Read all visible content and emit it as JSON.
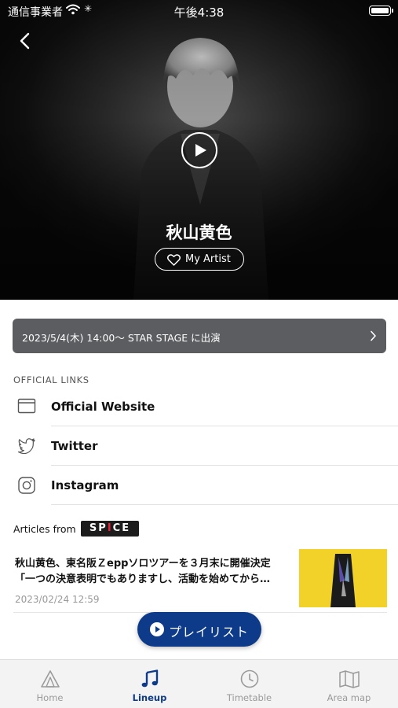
{
  "status_bar": {
    "carrier": "通信事業者",
    "time": "午後4:38"
  },
  "artist": {
    "name": "秋山黄色",
    "my_artist_label": "My Artist"
  },
  "performance": {
    "text": "2023/5/4(木) 14:00～ STAR STAGE に出演"
  },
  "official_links": {
    "heading": "OFFICIAL LINKS",
    "items": [
      {
        "label": "Official Website",
        "icon": "browser-icon"
      },
      {
        "label": "Twitter",
        "icon": "twitter-icon"
      },
      {
        "label": "Instagram",
        "icon": "instagram-icon"
      }
    ]
  },
  "articles": {
    "heading": "Articles from",
    "source_logo_left": "SP",
    "source_logo_accent": "I",
    "source_logo_right": "CE",
    "items": [
      {
        "title_line1": "秋山黄色、東名阪Ｚeppソロツアーを３月末に開催決定",
        "title_line2": "「一つの決意表明でもありますし、活動を始めてから…",
        "date": "2023/02/24 12:59"
      }
    ]
  },
  "playlist_button": {
    "label": "プレイリスト"
  },
  "tabs": [
    {
      "label": "Home",
      "icon": "home-icon",
      "active": false
    },
    {
      "label": "Lineup",
      "icon": "music-note-icon",
      "active": true
    },
    {
      "label": "Timetable",
      "icon": "clock-icon",
      "active": false
    },
    {
      "label": "Area map",
      "icon": "map-icon",
      "active": false
    }
  ],
  "colors": {
    "accent": "#0d3b89",
    "performance_bar": "#5c5d60",
    "thumbnail": "#f2d228"
  }
}
